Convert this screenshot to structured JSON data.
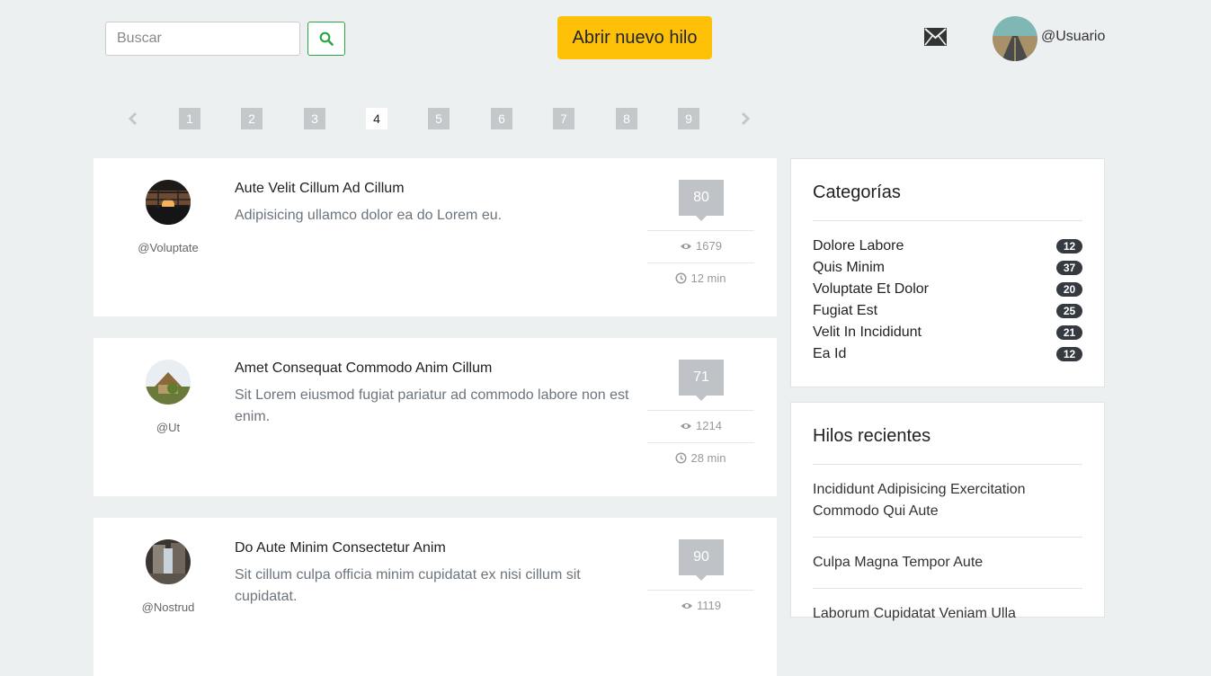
{
  "header": {
    "search_placeholder": "Buscar",
    "new_thread_label": "Abrir nuevo hilo",
    "username": "@Usuario"
  },
  "pagination": {
    "pages": [
      "1",
      "2",
      "3",
      "4",
      "5",
      "6",
      "7",
      "8",
      "9"
    ],
    "current": "4"
  },
  "threads": [
    {
      "author": "@Voluptate",
      "title": "Aute Velit Cillum Ad Cillum",
      "excerpt": "Adipisicing ullamco dolor ea do Lorem eu.",
      "replies": "80",
      "views": "1679",
      "time": "12 min"
    },
    {
      "author": "@Ut",
      "title": "Amet Consequat Commodo Anim Cillum",
      "excerpt": "Sit Lorem eiusmod fugiat pariatur ad commodo labore non est enim.",
      "replies": "71",
      "views": "1214",
      "time": "28 min"
    },
    {
      "author": "@Nostrud",
      "title": "Do Aute Minim Consectetur Anim",
      "excerpt": "Sit cillum culpa officia minim cupidatat ex nisi cillum sit cupidatat.",
      "replies": "90",
      "views": "1119",
      "time": ""
    }
  ],
  "categories": {
    "title": "Categorías",
    "items": [
      {
        "name": "Dolore Labore",
        "count": "12"
      },
      {
        "name": "Quis Minim",
        "count": "37"
      },
      {
        "name": "Voluptate Et Dolor",
        "count": "20"
      },
      {
        "name": "Fugiat Est",
        "count": "25"
      },
      {
        "name": "Velit In Incididunt",
        "count": "21"
      },
      {
        "name": "Ea Id",
        "count": "12"
      }
    ]
  },
  "recent": {
    "title": "Hilos recientes",
    "items": [
      "Incididunt Adipisicing Exercitation Commodo Qui Aute",
      "Culpa Magna Tempor Aute",
      "Laborum Cupidatat Veniam Ulla"
    ]
  },
  "colors": {
    "background": "#ecf0f1",
    "accent_button": "#ffc107",
    "search_button_border": "#28a745",
    "page_inactive": "#c4c8cb",
    "badge": "#343a40"
  },
  "icons": [
    "search-icon",
    "mail-icon",
    "chevron-left-icon",
    "chevron-right-icon",
    "eye-icon",
    "clock-icon"
  ]
}
